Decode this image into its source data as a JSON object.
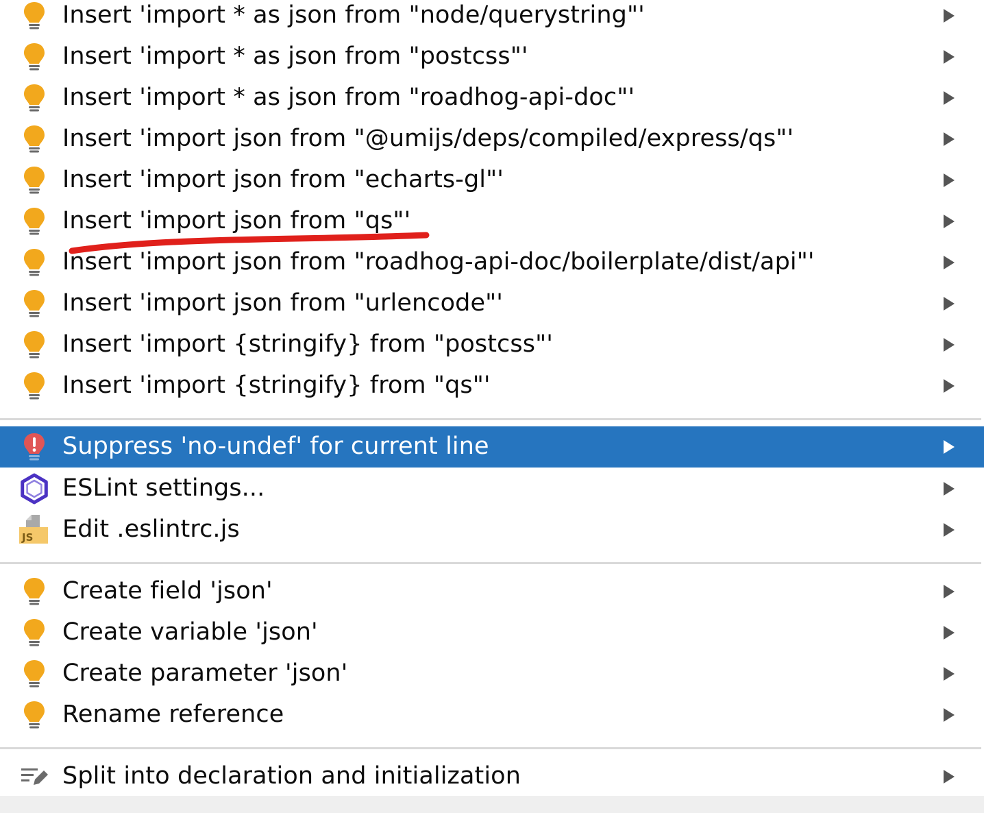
{
  "menu": {
    "items": [
      {
        "label": "Insert 'import * as json from \"node/querystring\"'",
        "icon": "bulb-icon"
      },
      {
        "label": "Insert 'import * as json from \"postcss\"'",
        "icon": "bulb-icon"
      },
      {
        "label": "Insert 'import * as json from \"roadhog-api-doc\"'",
        "icon": "bulb-icon"
      },
      {
        "label": "Insert 'import json from \"@umijs/deps/compiled/express/qs\"'",
        "icon": "bulb-icon"
      },
      {
        "label": "Insert 'import json from \"echarts-gl\"'",
        "icon": "bulb-icon"
      },
      {
        "label": "Insert 'import json from \"qs\"'",
        "icon": "bulb-icon"
      },
      {
        "label": "Insert 'import json from \"roadhog-api-doc/boilerplate/dist/api\"'",
        "icon": "bulb-icon"
      },
      {
        "label": "Insert 'import json from \"urlencode\"'",
        "icon": "bulb-icon"
      },
      {
        "label": "Insert 'import {stringify} from \"postcss\"'",
        "icon": "bulb-icon"
      },
      {
        "label": "Insert 'import {stringify} from \"qs\"'",
        "icon": "bulb-icon"
      },
      {
        "label": "Suppress 'no-undef' for current line",
        "icon": "error-bulb-icon",
        "selected": true
      },
      {
        "label": "ESLint settings...",
        "icon": "eslint-icon"
      },
      {
        "label": "Edit .eslintrc.js",
        "icon": "js-file-icon"
      },
      {
        "label": "Create field 'json'",
        "icon": "bulb-icon"
      },
      {
        "label": "Create variable 'json'",
        "icon": "bulb-icon"
      },
      {
        "label": "Create parameter 'json'",
        "icon": "bulb-icon"
      },
      {
        "label": "Rename reference",
        "icon": "bulb-icon"
      },
      {
        "label": "Split into declaration and initialization",
        "icon": "edit-icon"
      }
    ],
    "js_badge": "JS"
  },
  "colors": {
    "selection": "#2675bf",
    "bulb": "#f2a81d",
    "error": "#e05555",
    "eslint": "#4b32c3",
    "annotation": "#e0201b"
  }
}
